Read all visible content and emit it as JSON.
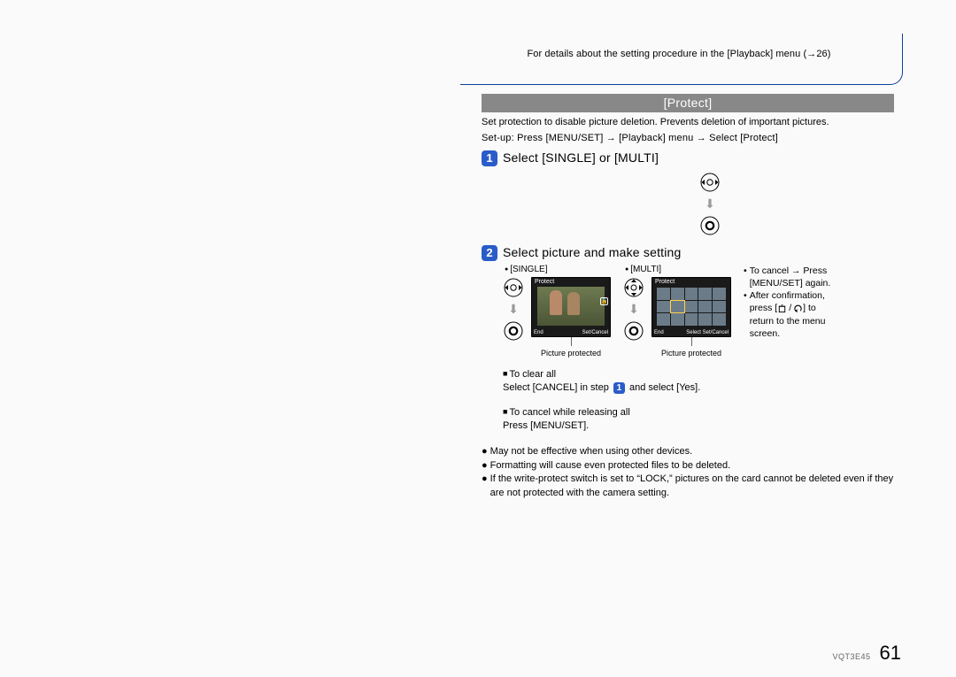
{
  "top_note": "For details about the setting procedure in the [Playback] menu (→26)",
  "section": {
    "title": "[Protect]",
    "desc": "Set protection to disable picture deletion. Prevents deletion of important pictures.",
    "setup": "Set-up: Press [MENU/SET] → [Playback] menu → Select [Protect]"
  },
  "step1": {
    "num": "1",
    "title": "Select [SINGLE] or [MULTI]"
  },
  "step2": {
    "num": "2",
    "title": "Select picture and make setting",
    "single_label": "[SINGLE]",
    "multi_label": "[MULTI]",
    "caption_single": "Picture protected",
    "caption_multi": "Picture protected",
    "lcd_single": {
      "title": "Protect",
      "b_left": "End",
      "b_right": "Set/Cancel"
    },
    "lcd_multi": {
      "title": "Protect",
      "b_left": "End",
      "b_right": "Select Set/Cancel"
    }
  },
  "side_notes": {
    "n1a": "To cancel → Press",
    "n1b": "[MENU/SET] again.",
    "n2a": "After confirmation,",
    "n2b_pre": "press [",
    "n2b_post": "] to",
    "n2c": "return to the menu",
    "n2d": "screen."
  },
  "clear_all": {
    "h": "To clear all",
    "t1": "Select [CANCEL] in step",
    "t2": "and select [Yes]."
  },
  "cancel_rel": {
    "h": "To cancel while releasing all",
    "t": "Press [MENU/SET]."
  },
  "notes": {
    "a": "May not be effective when using other devices.",
    "b": "Formatting will cause even protected files to be deleted.",
    "c": "If the write-protect switch is set to “LOCK,” pictures on the card cannot be deleted even if they are not protected with the camera setting."
  },
  "footer": {
    "code": "VQT3E45",
    "page": "61"
  }
}
